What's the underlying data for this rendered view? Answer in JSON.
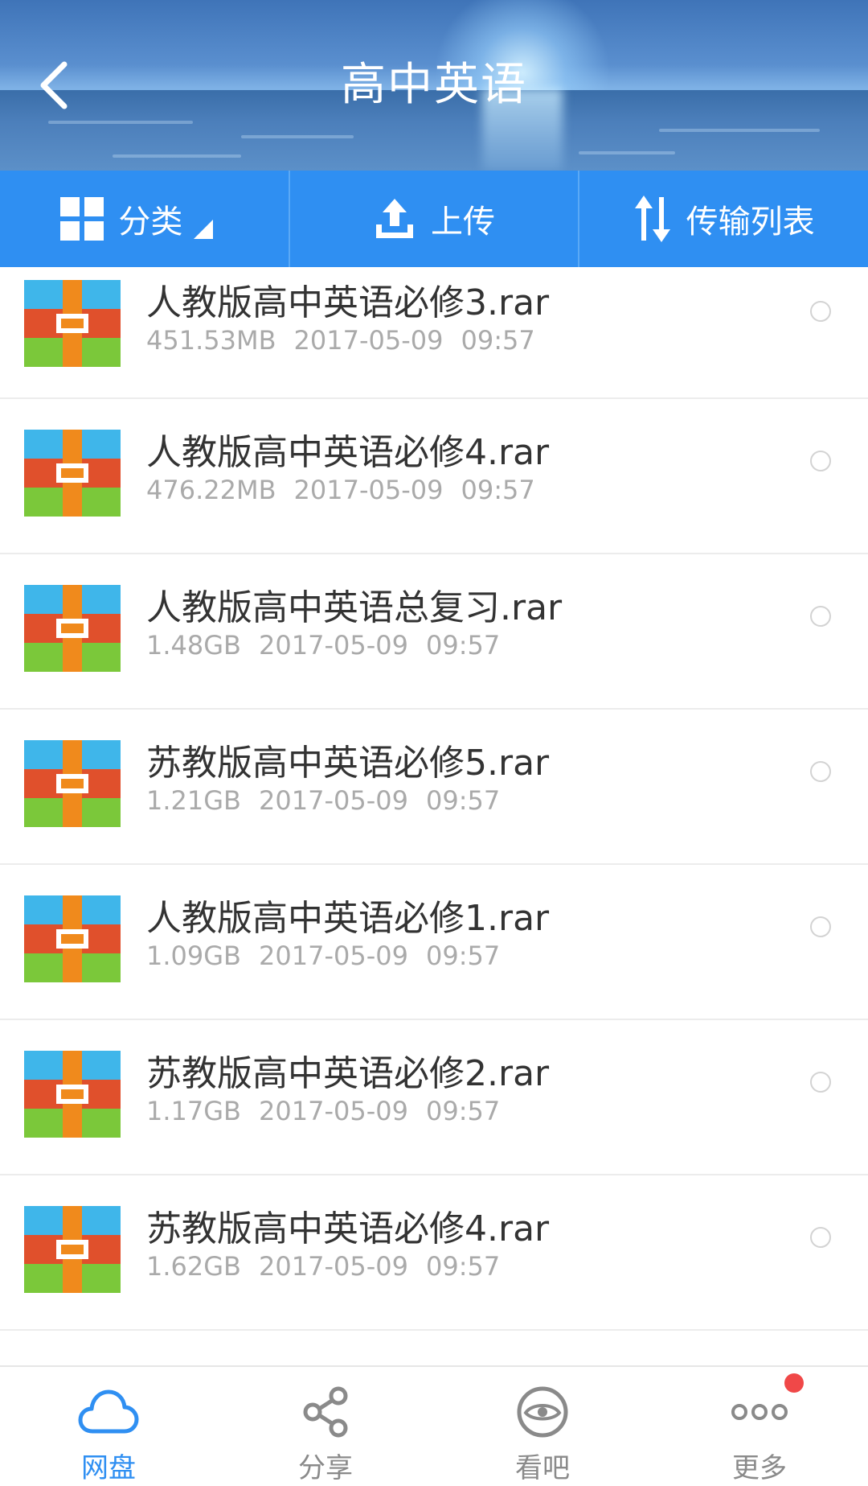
{
  "header": {
    "title": "高中英语"
  },
  "toolbar": {
    "category_label": "分类",
    "upload_label": "上传",
    "transfer_label": "传输列表"
  },
  "files": [
    {
      "name": "人教版高中英语必修3.rar",
      "size": "451.53MB",
      "date": "2017-05-09",
      "time": "09:57"
    },
    {
      "name": "人教版高中英语必修4.rar",
      "size": "476.22MB",
      "date": "2017-05-09",
      "time": "09:57"
    },
    {
      "name": "人教版高中英语总复习.rar",
      "size": "1.48GB",
      "date": "2017-05-09",
      "time": "09:57"
    },
    {
      "name": "苏教版高中英语必修5.rar",
      "size": "1.21GB",
      "date": "2017-05-09",
      "time": "09:57"
    },
    {
      "name": "人教版高中英语必修1.rar",
      "size": "1.09GB",
      "date": "2017-05-09",
      "time": "09:57"
    },
    {
      "name": "苏教版高中英语必修2.rar",
      "size": "1.17GB",
      "date": "2017-05-09",
      "time": "09:57"
    },
    {
      "name": "苏教版高中英语必修4.rar",
      "size": "1.62GB",
      "date": "2017-05-09",
      "time": "09:57"
    }
  ],
  "bottom_nav": {
    "items": [
      {
        "label": "网盘",
        "icon": "cloud-icon"
      },
      {
        "label": "分享",
        "icon": "share-icon"
      },
      {
        "label": "看吧",
        "icon": "eye-icon"
      },
      {
        "label": "更多",
        "icon": "more-icon"
      }
    ]
  },
  "colors": {
    "accent": "#2f8ff2",
    "badge": "#f04848",
    "text_primary": "#333333",
    "text_secondary": "#aaaaaa"
  }
}
